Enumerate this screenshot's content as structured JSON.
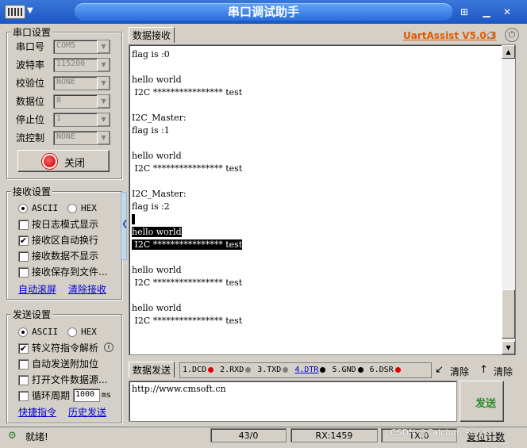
{
  "window": {
    "title": "串口调试助手"
  },
  "serial_settings": {
    "group_title": "串口设置",
    "fields": [
      {
        "label": "串口号",
        "value": "COM5"
      },
      {
        "label": "波特率",
        "value": "115200"
      },
      {
        "label": "校验位",
        "value": "NONE"
      },
      {
        "label": "数据位",
        "value": "8"
      },
      {
        "label": "停止位",
        "value": "1"
      },
      {
        "label": "流控制",
        "value": "NONE"
      }
    ],
    "toggle_button": "关闭"
  },
  "receive_settings": {
    "group_title": "接收设置",
    "mode_ascii": "ASCII",
    "mode_hex": "HEX",
    "selected_mode": "ASCII",
    "options": [
      {
        "label": "按日志模式显示",
        "checked": false
      },
      {
        "label": "接收区自动换行",
        "checked": true
      },
      {
        "label": "接收数据不显示",
        "checked": false
      },
      {
        "label": "接收保存到文件...",
        "checked": false
      }
    ],
    "link_auto_scroll": "自动滚屏",
    "link_clear": "清除接收"
  },
  "send_settings": {
    "group_title": "发送设置",
    "mode_ascii": "ASCII",
    "mode_hex": "HEX",
    "selected_mode": "ASCII",
    "options": [
      {
        "label": "转义符指令解析",
        "checked": true
      },
      {
        "label": "自动发送附加位",
        "checked": false
      },
      {
        "label": "打开文件数据源...",
        "checked": false
      },
      {
        "label": "循环周期",
        "checked": false
      }
    ],
    "cycle_value": "1000",
    "cycle_unit": "ms",
    "link_shortcuts": "快捷指令",
    "link_history": "历史发送"
  },
  "receive_panel": {
    "tab_label": "数据接收",
    "brand": "UartAssist V5.0.3",
    "brand_color": "#e05a00",
    "lines": [
      {
        "text": "flag is :0",
        "highlight": false
      },
      {
        "text": "",
        "highlight": false
      },
      {
        "text": "hello world",
        "highlight": false
      },
      {
        "text": " I2C **************** test",
        "highlight": false
      },
      {
        "text": "",
        "highlight": false
      },
      {
        "text": "I2C_Master:",
        "highlight": false
      },
      {
        "text": "flag is :1",
        "highlight": false
      },
      {
        "text": "",
        "highlight": false
      },
      {
        "text": "hello world",
        "highlight": false
      },
      {
        "text": " I2C **************** test",
        "highlight": false
      },
      {
        "text": "",
        "highlight": false
      },
      {
        "text": "I2C_Master:",
        "highlight": false
      },
      {
        "text": "flag is :2",
        "highlight": false
      },
      {
        "text": " ",
        "highlight": true
      },
      {
        "text": "hello world",
        "highlight": true
      },
      {
        "text": " I2C **************** test",
        "highlight": true
      },
      {
        "text": "",
        "highlight": false
      },
      {
        "text": "hello world",
        "highlight": false
      },
      {
        "text": " I2C **************** test",
        "highlight": false
      },
      {
        "text": "",
        "highlight": false
      },
      {
        "text": "hello world",
        "highlight": false
      },
      {
        "text": " I2C **************** test",
        "highlight": false
      }
    ]
  },
  "send_panel": {
    "tab_label": "数据发送",
    "signals": [
      {
        "label": "1.DCD",
        "color": "#e00000",
        "active": false
      },
      {
        "label": "2.RXD",
        "color": "#808080",
        "active": false
      },
      {
        "label": "3.TXD",
        "color": "#808080",
        "active": false
      },
      {
        "label": "4.DTR",
        "color": "#000000",
        "active": true
      },
      {
        "label": "5.GND",
        "color": "#000000",
        "active": false
      },
      {
        "label": "6.DSR",
        "color": "#e00000",
        "active": false
      }
    ],
    "clear_1": "清除",
    "clear_2": "清除",
    "input_value": "http://www.cmsoft.cn",
    "send_button": "发送",
    "send_button_color": "#2a8a2a"
  },
  "status_bar": {
    "status": "就绪!",
    "counter": "43/0",
    "rx": "RX:1459",
    "tx": "TX:0",
    "reset_button": "复位计数"
  },
  "watermark": "CSDN @Calcium Ruiyi"
}
